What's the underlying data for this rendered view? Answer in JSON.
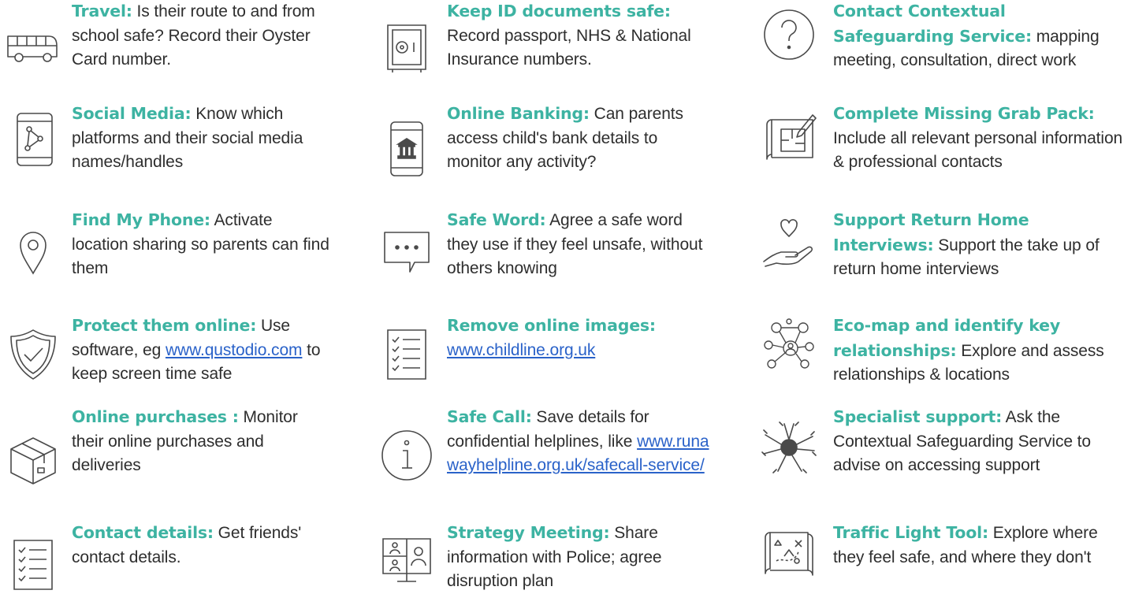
{
  "colors": {
    "heading": "#3db3a2",
    "body_text": "#2e2e2e",
    "link": "#2a62c9",
    "icon_stroke": "#4a4a4a"
  },
  "items": [
    {
      "icon": "bus-icon",
      "heading": "Travel:",
      "body": " Is their route to and from school safe? Record their Oyster Card number."
    },
    {
      "icon": "phone-network-icon",
      "heading": "Social Media:",
      "body": " Know which platforms and their social media names/handles"
    },
    {
      "icon": "location-pin-icon",
      "heading": "Find My Phone:",
      "body": " Activate location sharing so parents can find them"
    },
    {
      "icon": "shield-check-icon",
      "heading": "Protect them online:",
      "body": " Use software, eg ",
      "link": "www.qustodio.com",
      "body_after": " to keep screen time safe"
    },
    {
      "icon": "parcel-box-icon",
      "heading": "Online purchases :",
      "body": " Monitor their online purchases and deliveries"
    },
    {
      "icon": "checklist-icon",
      "heading": "Contact details:",
      "body": " Get friends' contact details."
    },
    {
      "icon": "safe-icon",
      "heading": "Keep ID documents safe:",
      "body": " Record passport, NHS & National Insurance numbers."
    },
    {
      "icon": "phone-bank-icon",
      "heading": "Online Banking:",
      "body": " Can parents access child's bank details to monitor any activity?"
    },
    {
      "icon": "speech-bubble-icon",
      "heading": "Safe Word:",
      "body": " Agree a safe word they use if they feel unsafe, without others knowing"
    },
    {
      "icon": "checklist-icon",
      "heading": "Remove online images:",
      "body": " ",
      "link": "www.childline.org.uk",
      "body_after": ""
    },
    {
      "icon": "info-icon",
      "heading": "Safe Call:",
      "body": " Save details for confidential helplines, like ",
      "link": "www.runawayhelpline.org.uk/safecall-service/",
      "body_after": ""
    },
    {
      "icon": "video-meeting-icon",
      "heading": "Strategy Meeting:",
      "body": " Share information with Police; agree disruption plan"
    },
    {
      "icon": "question-icon",
      "heading": "Contact Contextual Safeguarding Service:",
      "body": " mapping meeting, consultation, direct work"
    },
    {
      "icon": "blueprint-pen-icon",
      "heading": "Complete Missing Grab Pack:",
      "body": " Include all relevant personal information & professional contacts"
    },
    {
      "icon": "hand-heart-icon",
      "heading": "Support Return Home Interviews:",
      "body": " Support the take up of return home interviews"
    },
    {
      "icon": "network-people-icon",
      "heading": "Eco-map and identify key relationships:",
      "body": " Explore and assess relationships & locations"
    },
    {
      "icon": "hands-together-icon",
      "heading": "Specialist support:",
      "body": " Ask the Contextual Safeguarding Service to advise on accessing support"
    },
    {
      "icon": "treasure-map-icon",
      "heading": "Traffic Light Tool:",
      "body": " Explore where they feel safe, and where they don't"
    }
  ]
}
